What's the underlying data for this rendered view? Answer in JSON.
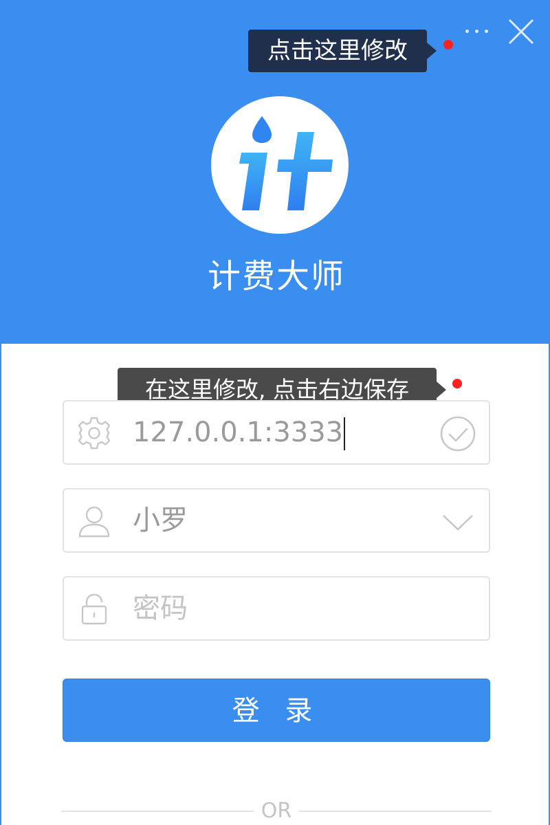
{
  "window": {
    "more_icon": "more-dots-icon",
    "close_icon": "close-x-icon"
  },
  "tooltips": {
    "top": "点击这里修改",
    "server": "在这里修改, 点击右边保存"
  },
  "app": {
    "logo_icon": "app-logo-ji-icon",
    "name": "计费大师"
  },
  "form": {
    "server": {
      "value": "127.0.0.1:3333",
      "icon": "gear-icon",
      "action_icon": "check-circle-icon"
    },
    "user": {
      "value": "小罗",
      "icon": "user-icon",
      "dropdown_icon": "chevron-down-icon"
    },
    "password": {
      "placeholder": "密码",
      "icon": "lock-icon"
    },
    "login_label": "登 录"
  },
  "divider": {
    "text": "OR"
  },
  "colors": {
    "accent": "#3a8ef0",
    "tooltip_dark": "#1f2f4c",
    "tooltip_gray": "#4a4a4a",
    "alert_dot": "#ff2020"
  }
}
